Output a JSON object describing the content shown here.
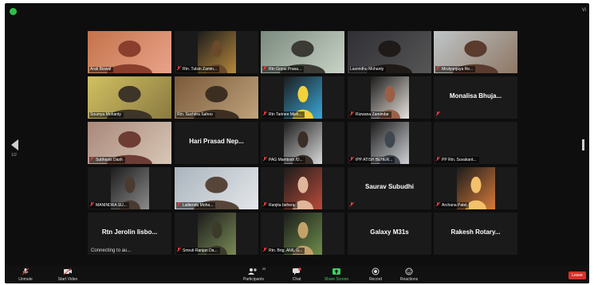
{
  "meeting": {
    "view_label": "Vi",
    "page_indicator": "1/2"
  },
  "tiles": [
    {
      "name": "Arati Biswal",
      "muted": false,
      "type": "video",
      "colors": [
        "#c4734a",
        "#e9a38b",
        "#8a3f2e"
      ]
    },
    {
      "name": "Rtn. Tulsin Zamin...",
      "muted": true,
      "type": "video-center",
      "colors": [
        "#1c1c1c",
        "#b7883c",
        "#6a4a2a"
      ]
    },
    {
      "name": "Rtn Gopal Prasa...",
      "muted": true,
      "type": "video",
      "colors": [
        "#7a8a7e",
        "#c9d3c6",
        "#3b3a35"
      ]
    },
    {
      "name": "Laxmidhu Mohanty",
      "muted": false,
      "type": "video",
      "colors": [
        "#2f2f35",
        "#565656",
        "#1f1a17"
      ]
    },
    {
      "name": "Mrutyunjaya Re...",
      "muted": true,
      "type": "video",
      "colors": [
        "#bfc5c9",
        "#8e7763",
        "#5a3b2d"
      ]
    },
    {
      "name": "Soumya Mohanty",
      "muted": false,
      "type": "video",
      "colors": [
        "#d1c061",
        "#8a7a41",
        "#3d3528"
      ]
    },
    {
      "name": "Rtn. Suchitra Sahoo",
      "muted": false,
      "type": "video",
      "active": true,
      "colors": [
        "#7b5a3a",
        "#bfa37c",
        "#3c2f22"
      ]
    },
    {
      "name": "Rtn Tarinee Mish...",
      "muted": true,
      "type": "video-center",
      "colors": [
        "#1c1c1c",
        "#3aa7d8",
        "#f2d23a"
      ]
    },
    {
      "name": "Rizwana Zamindar",
      "muted": true,
      "type": "video-center",
      "colors": [
        "#1c1c1c",
        "#e9e2dc",
        "#9b5f48"
      ]
    },
    {
      "name": "Monalisa Bhuja...",
      "muted": true,
      "type": "name-only",
      "colors": []
    },
    {
      "name": "Subhasis Dash",
      "muted": true,
      "type": "video",
      "colors": [
        "#a9887a",
        "#d8c7b6",
        "#6d3c33"
      ]
    },
    {
      "name": "Hari Prasad Nep...",
      "muted": false,
      "type": "name-only",
      "colors": []
    },
    {
      "name": "PAG Mamtosh /D...",
      "muted": true,
      "type": "video-center",
      "colors": [
        "#1c1c1c",
        "#d9d9d9",
        "#3a2e27"
      ]
    },
    {
      "name": "IPP ATISH BEHER...",
      "muted": true,
      "type": "video-center",
      "colors": [
        "#1c1c1c",
        "#cfd1d6",
        "#3f4650"
      ]
    },
    {
      "name": "PP Rtn. Suvakant...",
      "muted": true,
      "type": "name-only-bottom",
      "colors": []
    },
    {
      "name": "MANINDRA SU...",
      "muted": true,
      "type": "video-center",
      "colors": [
        "#1c1c1c",
        "#8c8c8c",
        "#4b3a30"
      ]
    },
    {
      "name": "Lalitendu Moha...",
      "muted": true,
      "type": "video",
      "colors": [
        "#aab4bd",
        "#e4e7ea",
        "#57453a"
      ]
    },
    {
      "name": "Ranjita behera",
      "muted": true,
      "type": "video-center",
      "colors": [
        "#1c1c1c",
        "#b84b3a",
        "#e0b59a"
      ]
    },
    {
      "name": "Saurav Subudhi",
      "muted": true,
      "type": "name-only",
      "colors": []
    },
    {
      "name": "Archana Patel",
      "muted": true,
      "type": "video-center",
      "colors": [
        "#1c1c1c",
        "#d77b3a",
        "#f3c16a"
      ]
    },
    {
      "name": "Rtn Jerolin Iisbo...",
      "muted": false,
      "type": "name-only",
      "sub": "Connecting to au...",
      "colors": []
    },
    {
      "name": "Smruti Ranjan Da...",
      "muted": true,
      "type": "video-center",
      "colors": [
        "#1c1c1c",
        "#7a8a55",
        "#3b3b2a"
      ]
    },
    {
      "name": "Rtn. Brig. ANIL G...",
      "muted": true,
      "type": "video-center",
      "colors": [
        "#1c1c1c",
        "#6c8d4a",
        "#c3a26a"
      ]
    },
    {
      "name": "Galaxy M31s",
      "muted": false,
      "type": "name-only",
      "colors": []
    },
    {
      "name": "Rakesh Rotary...",
      "muted": false,
      "type": "name-only",
      "colors": []
    }
  ],
  "toolbar": {
    "unmute": "Unmute",
    "start_video": "Start Video",
    "participants": "Participants",
    "participants_count": "33",
    "chat": "Chat",
    "share_screen": "Share Screen",
    "record": "Record",
    "reactions": "Reactions",
    "leave": "Leave"
  },
  "colors": {
    "background": "#0e0e0e",
    "active_speaker": "#d6cc4a",
    "muted_red": "#e23b3b",
    "share_green": "#3ecf5e",
    "leave_red": "#d9302b"
  }
}
